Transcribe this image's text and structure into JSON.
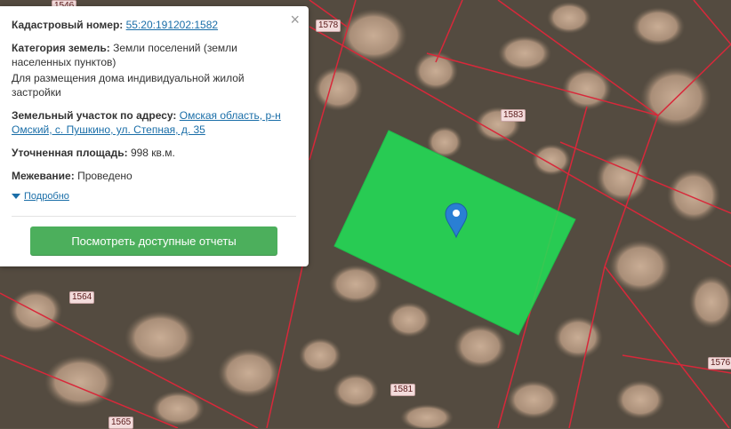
{
  "popup": {
    "cadastral_label": "Кадастровый номер:",
    "cadastral_number": "55:20:191202:1582",
    "category_label": "Категория земель:",
    "category_value": "Земли поселений (земли населенных пунктов)",
    "usage_value": "Для размещения дома индивидуальной жилой застройки",
    "address_label": "Земельный участок по адресу:",
    "address_value": "Омская область, р-н Омский, с. Пушкино, ул. Степная, д. 35",
    "area_label": "Уточненная площадь:",
    "area_value": "998 кв.м.",
    "survey_label": "Межевание:",
    "survey_value": "Проведено",
    "more_label": "Подробно",
    "reports_button": "Посмотреть доступные отчеты",
    "close_icon": "×"
  },
  "map": {
    "parcel_labels": [
      "1578",
      "1546",
      "1583",
      "1564",
      "1576",
      "1581",
      "1565"
    ],
    "selected_color": "#22dd55",
    "boundary_color": "#d8283a",
    "marker_color": "#2a7fd4"
  }
}
